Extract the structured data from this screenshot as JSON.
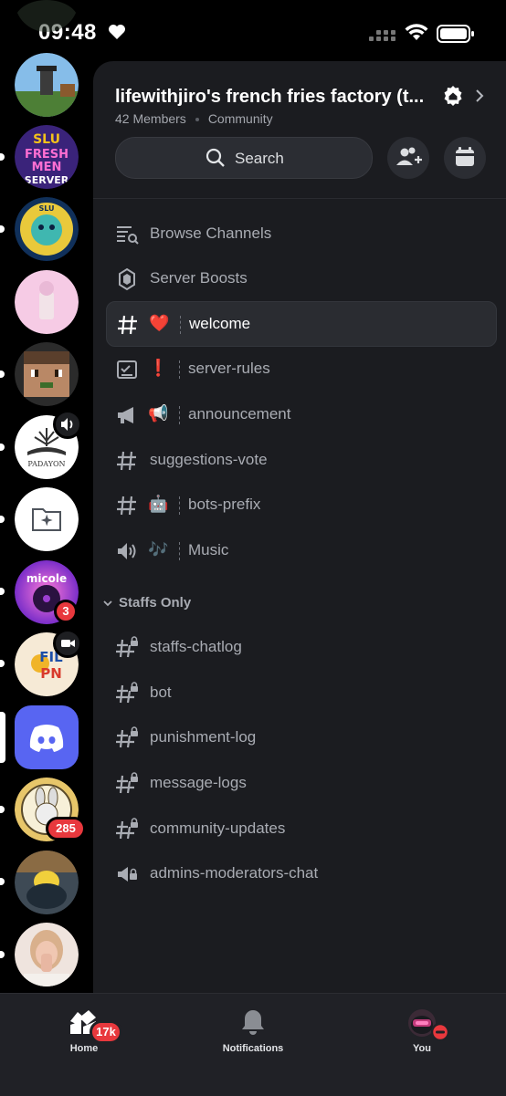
{
  "status": {
    "time": "09:48"
  },
  "servers": [
    {
      "name": "farm-avatar-server",
      "colors": [
        "#7fb3e6",
        "#3f6a2f"
      ]
    },
    {
      "name": "slu-freshmen-server",
      "label": "SLU FRESH MEN SERVER",
      "colors": [
        "#4a2a8f",
        "#f0c419"
      ]
    },
    {
      "name": "slu-official-discord",
      "label": "SLU",
      "colors": [
        "#13325c",
        "#3fb7b0"
      ]
    },
    {
      "name": "pink-server",
      "colors": [
        "#f6cde6",
        "#e6a4cc"
      ]
    },
    {
      "name": "minecraft-server",
      "colors": [
        "#5b4633",
        "#c08f6a"
      ]
    },
    {
      "name": "padayon-server",
      "label": "PADAYON",
      "colors": [
        "#ffffff",
        "#2a2a2a"
      ]
    },
    {
      "name": "folder-server",
      "colors": [
        "#ffffff",
        "#4f545c"
      ]
    },
    {
      "name": "micole-server",
      "label": "micole",
      "colors": [
        "#9b3fd1",
        "#ff7bd8"
      ],
      "badge": "3"
    },
    {
      "name": "filipino-server",
      "label": "FIL PIN IO",
      "colors": [
        "#f6ead6",
        "#d83a2c"
      ]
    },
    {
      "name": "discord-server",
      "colors": [
        "#5865f2",
        "#ffffff"
      ]
    },
    {
      "name": "bunny-server",
      "colors": [
        "#e7c66a",
        "#5a4a2a"
      ],
      "badge": "285"
    },
    {
      "name": "duck-server",
      "colors": [
        "#3e4a55",
        "#f1d03c"
      ]
    },
    {
      "name": "girl-server",
      "colors": [
        "#e9d2c9",
        "#c98f7a"
      ]
    }
  ],
  "server": {
    "name": "lifewithjiro's french fries factory (t...",
    "members": "42 Members",
    "type": "Community",
    "search_label": "Search"
  },
  "menu": [
    {
      "label": "Browse Channels",
      "icon": "browse-channels-icon"
    },
    {
      "label": "Server Boosts",
      "icon": "server-boost-icon"
    }
  ],
  "channels": [
    {
      "name": "welcome",
      "icon": "hashtag-icon",
      "emoji": "❤️",
      "selected": true
    },
    {
      "name": "server-rules",
      "icon": "rules-icon",
      "emoji": "❗"
    },
    {
      "name": "announcement",
      "icon": "megaphone-icon",
      "emoji": "📢"
    },
    {
      "name": "suggestions-vote",
      "icon": "hashtag-icon"
    },
    {
      "name": "bots-prefix",
      "icon": "hashtag-icon",
      "emoji": "🤖"
    },
    {
      "name": "Music",
      "icon": "speaker-icon",
      "emoji": "🎶"
    }
  ],
  "category": {
    "label": "Staffs Only"
  },
  "private_channels": [
    {
      "name": "staffs-chatlog",
      "icon": "locked-hashtag-icon"
    },
    {
      "name": "bot",
      "icon": "locked-hashtag-icon"
    },
    {
      "name": "punishment-log",
      "icon": "locked-hashtag-icon"
    },
    {
      "name": "message-logs",
      "icon": "locked-hashtag-icon"
    },
    {
      "name": "community-updates",
      "icon": "locked-hashtag-icon"
    },
    {
      "name": "admins-moderators-chat",
      "icon": "locked-announcement-icon"
    }
  ],
  "tabs": [
    {
      "label": "Home",
      "badge": "17k",
      "active": true
    },
    {
      "label": "Notifications"
    },
    {
      "label": "You",
      "status": "do-not-disturb"
    }
  ]
}
